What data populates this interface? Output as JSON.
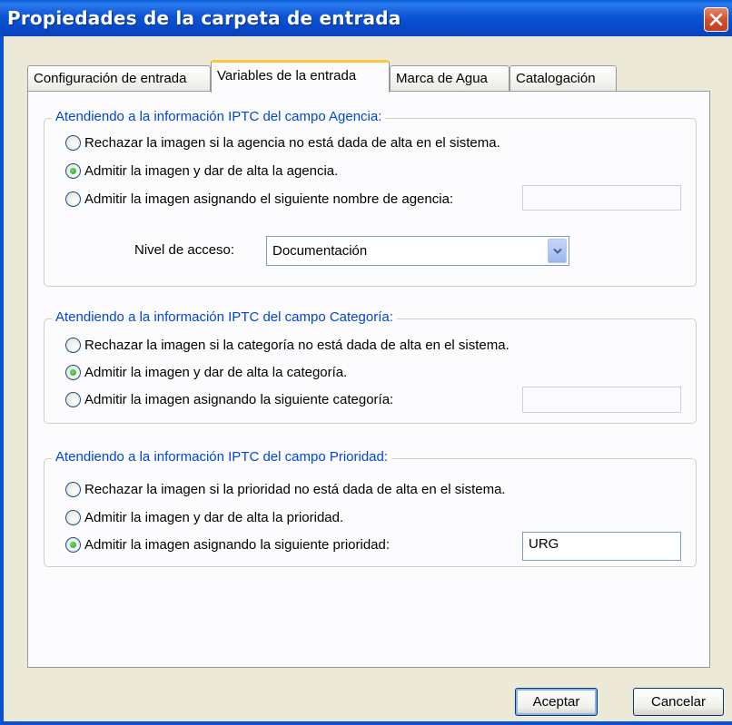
{
  "window": {
    "title": "Propiedades de la carpeta de entrada"
  },
  "tabs": [
    {
      "label": "Configuración de entrada",
      "active": false
    },
    {
      "label": "Variables de la entrada",
      "active": true
    },
    {
      "label": "Marca de Agua",
      "active": false
    },
    {
      "label": "Catalogación",
      "active": false
    }
  ],
  "agencia": {
    "legend": "Atendiendo a la información IPTC del campo Agencia:",
    "options": [
      {
        "label": "Rechazar la imagen si la agencia no está dada de alta en el sistema.",
        "checked": false
      },
      {
        "label": "Admitir la imagen y dar de alta la agencia.",
        "checked": true
      },
      {
        "label": "Admitir la imagen asignando el siguiente nombre de agencia:",
        "checked": false
      }
    ],
    "name_value": "",
    "access_label": "Nivel de acceso:",
    "access_value": "Documentación"
  },
  "categoria": {
    "legend": "Atendiendo a la información IPTC del campo Categoría:",
    "options": [
      {
        "label": "Rechazar la imagen si la categoría no está dada de alta en el sistema.",
        "checked": false
      },
      {
        "label": "Admitir la imagen y dar de alta la categoría.",
        "checked": true
      },
      {
        "label": "Admitir la imagen asignando la siguiente categoría:",
        "checked": false
      }
    ],
    "value": ""
  },
  "prioridad": {
    "legend": "Atendiendo a la información IPTC del campo Prioridad:",
    "options": [
      {
        "label": "Rechazar la imagen si la prioridad no está dada de alta en el sistema.",
        "checked": false
      },
      {
        "label": "Admitir la imagen y dar de alta la prioridad.",
        "checked": false
      },
      {
        "label": "Admitir la imagen asignando la siguiente prioridad:",
        "checked": true
      }
    ],
    "value": "URG"
  },
  "buttons": {
    "accept": "Aceptar",
    "cancel": "Cancelar"
  },
  "colors": {
    "titlebar": "#0b55d6",
    "legend": "#0046d5",
    "close": "#d3512d"
  },
  "icons": [
    "close-icon",
    "chevron-down-icon"
  ]
}
